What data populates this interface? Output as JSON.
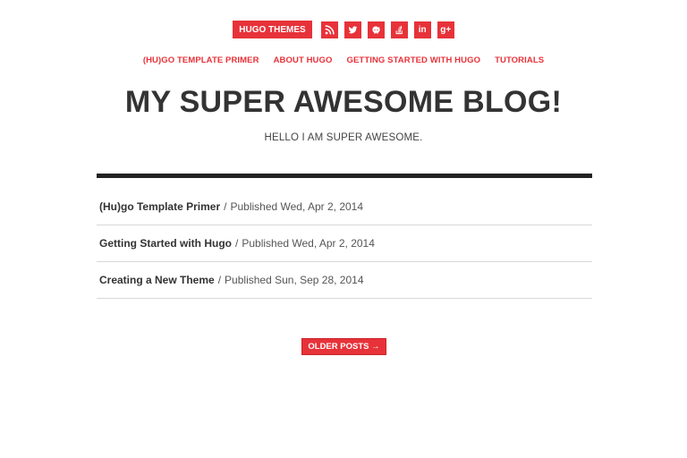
{
  "header": {
    "brand_label": "HUGO THEMES",
    "social": [
      {
        "icon": "rss-icon"
      },
      {
        "icon": "twitter-icon"
      },
      {
        "icon": "github-icon"
      },
      {
        "icon": "stackoverflow-icon"
      },
      {
        "icon": "linkedin-icon",
        "glyph": "in"
      },
      {
        "icon": "google-plus-icon",
        "glyph": "g+"
      }
    ]
  },
  "nav": {
    "items": [
      {
        "label": "(HU)GO TEMPLATE PRIMER"
      },
      {
        "label": "ABOUT HUGO"
      },
      {
        "label": "GETTING STARTED WITH HUGO"
      },
      {
        "label": "TUTORIALS"
      }
    ]
  },
  "site": {
    "title": "MY SUPER AWESOME BLOG!",
    "tagline": "HELLO I AM SUPER AWESOME."
  },
  "posts": [
    {
      "title": "(Hu)go Template Primer",
      "separator": "/",
      "meta": "Published Wed, Apr 2, 2014"
    },
    {
      "title": "Getting Started with Hugo",
      "separator": "/",
      "meta": "Published Wed, Apr 2, 2014"
    },
    {
      "title": "Creating a New Theme",
      "separator": "/",
      "meta": "Published Sun, Sep 28, 2014"
    }
  ],
  "pagination": {
    "older_label": "OLDER POSTS →"
  },
  "colors": {
    "accent": "#e73239",
    "text": "#333333",
    "rule": "#222222"
  }
}
